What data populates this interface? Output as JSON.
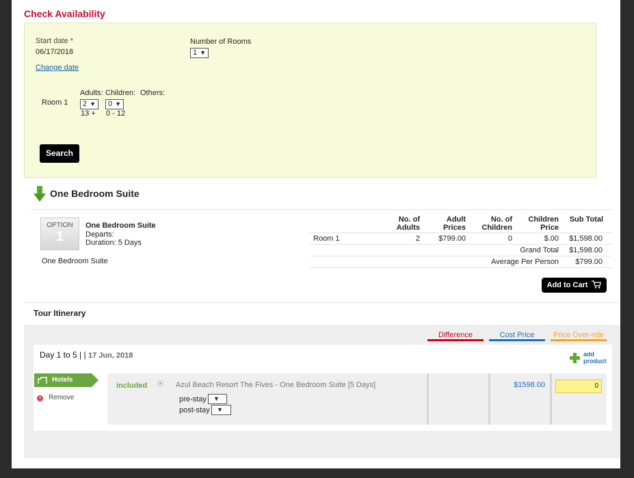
{
  "availability": {
    "title": "Check Availability",
    "start_date_label": "Start date",
    "required_mark": "*",
    "start_date_value": "06/17/2018",
    "change_date_link": "Change date",
    "rooms_label": "Number of Rooms",
    "rooms_value": "1",
    "room_label": "Room 1",
    "adults_label": "Adults:",
    "children_label": "Children:",
    "others_label": "Others:",
    "adults_value": "2",
    "children_value": "0",
    "adults_range": "13 +",
    "children_range": "0 - 12",
    "search_button": "Search"
  },
  "product": {
    "heading": "One Bedroom Suite",
    "option_label": "OPTION",
    "option_number": "1",
    "name": "One Bedroom Suite",
    "departs": "Departs:",
    "duration": "Duration: 5 Days",
    "description": "One Bedroom Suite",
    "table": {
      "headers": {
        "adults_1": "No. of",
        "adults_2": "Adults",
        "adult_prices_1": "Adult",
        "adult_prices_2": "Prices",
        "children_1": "No. of",
        "children_2": "Children",
        "children_price_1": "Children",
        "children_price_2": "Price",
        "subtotal": "Sub Total"
      },
      "row": {
        "room": "Room 1",
        "adults": "2",
        "adult_price": "$799.00",
        "children": "0",
        "children_price": "$.00",
        "subtotal": "$1,598.00"
      },
      "grand_total_label": "Grand Total",
      "grand_total_value": "$1,598.00",
      "avg_label": "Average Per Person",
      "avg_value": "$799.00"
    },
    "add_to_cart": "Add to Cart"
  },
  "itinerary": {
    "title": "Tour Itinerary",
    "columns": {
      "difference": "Difference",
      "cost_price": "Cost Price",
      "price_override": "Price Over-ride"
    },
    "column_colors": {
      "difference": "#d0021b",
      "cost_price": "#1f6cc6",
      "price_override": "#f5a623"
    },
    "day_label": "Day 1 to 5",
    "day_separator": "| |",
    "day_date": "17 Jun, 2018",
    "add_product_1": "add",
    "add_product_2": "product",
    "category_tag": "Hotels",
    "remove_label": "Remove",
    "status": "included",
    "item_name": "Azul Beach Resort The Fives - One Bedroom Suite [5 Days]",
    "pre_stay_label": "pre-stay",
    "post_stay_label": "post-stay",
    "cost_value": "$1598.00",
    "override_value": "0"
  }
}
